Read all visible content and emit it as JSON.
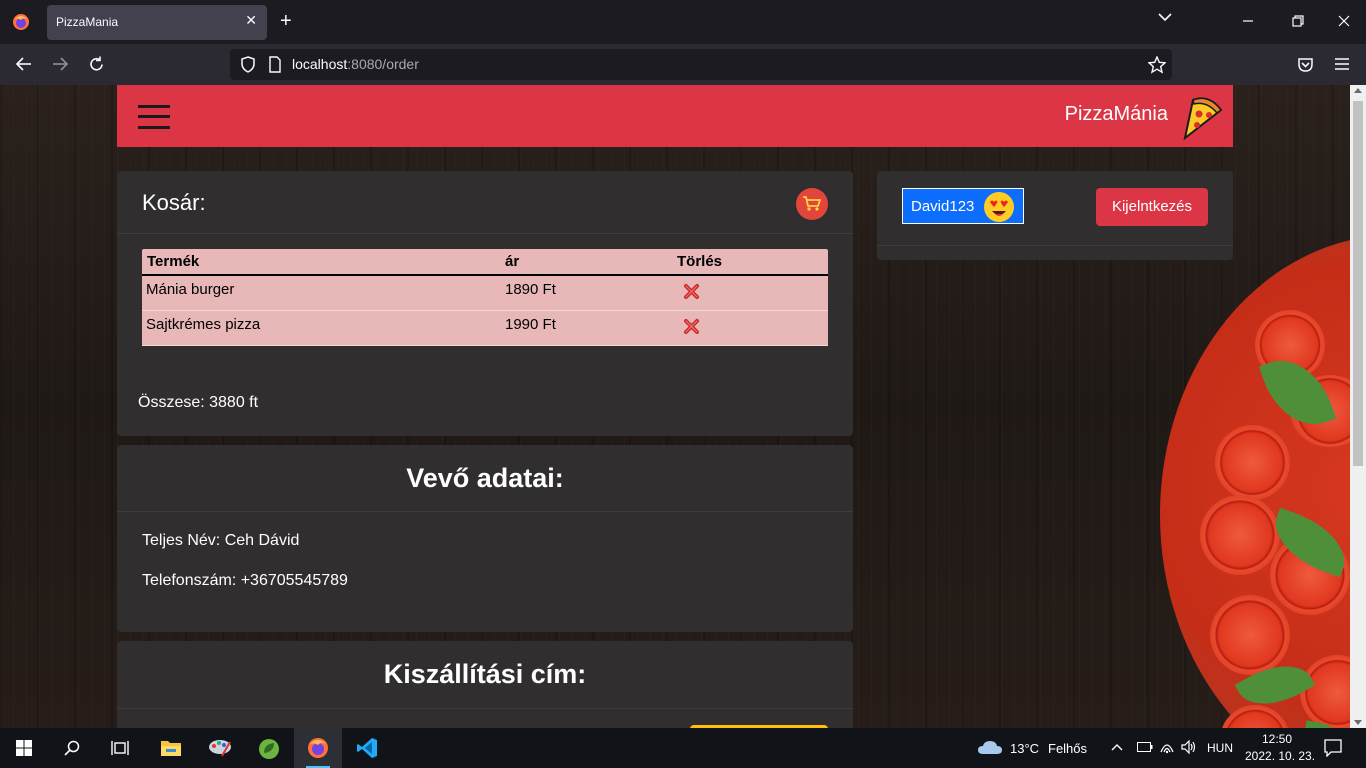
{
  "browser": {
    "tab_title": "PizzaMania",
    "tab_close": "✕",
    "new_tab": "+",
    "url_host": "localhost",
    "url_rest": ":8080/order"
  },
  "header": {
    "brand": "PizzaMánia"
  },
  "cart": {
    "title": "Kosár:",
    "columns": [
      "Termék",
      "ár",
      "Törlés"
    ],
    "rows": [
      {
        "product": "Mánia burger",
        "price": "1890 Ft"
      },
      {
        "product": "Sajtkrémes pizza",
        "price": "1990 Ft"
      }
    ],
    "total": "Összese: 3880 ft"
  },
  "user": {
    "username": "David123",
    "logout_label": "Kijelntkezés"
  },
  "customer": {
    "title": "Vevő adatai:",
    "full_name": "Teljes Név: Ceh Dávid",
    "phone": "Telefonszám: +36705545789"
  },
  "shipping": {
    "title": "Kiszállítási cím:"
  },
  "taskbar": {
    "weather_temp": "13°C",
    "weather_desc": "Felhős",
    "language": "HUN",
    "time": "12:50",
    "date": "2022. 10. 23."
  },
  "colors": {
    "brand_red": "#dc3545",
    "card_bg": "#302e2e",
    "table_bg": "#e8b7b7",
    "user_badge_blue": "#0d6efd",
    "accent_yellow": "#ffc107"
  }
}
